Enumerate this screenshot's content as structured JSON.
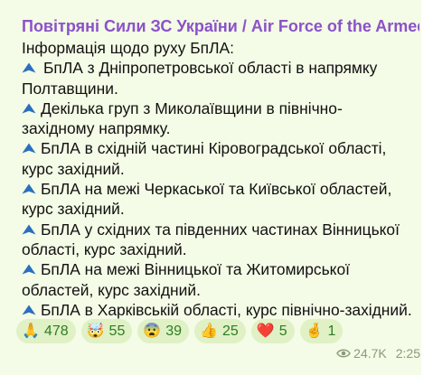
{
  "post": {
    "channel": "Повітряні Сили ЗС України / Air Force of the Armed F...",
    "heading": "Інформація щодо руху БпЛА:",
    "items": [
      [
        "БпЛА з Дніпропетровської області в напрямку",
        "Полтавщини."
      ],
      [
        "Декілька груп з Миколаївщини в північно-",
        "західному напрямку."
      ],
      [
        "БпЛА в східній частині Кіровоградської області,",
        "курс західний."
      ],
      [
        "БпЛА на межі Черкаської та Київської областей,",
        "курс західний."
      ],
      [
        "БпЛА у східних та південних частинах Вінницької",
        "області, курс західний."
      ],
      [
        "БпЛА на межі Вінницької та Житомирської",
        "областей, курс західний."
      ],
      [
        "БпЛА в Харківській області, курс північно-західний."
      ]
    ],
    "item_icon": "drone-icon"
  },
  "reactions": [
    {
      "emoji": "🙏",
      "count": "478",
      "icon": "pray-icon"
    },
    {
      "emoji": "🤯",
      "count": "55",
      "icon": "mind-blown-icon"
    },
    {
      "emoji": "😨",
      "count": "39",
      "icon": "fearful-face-icon"
    },
    {
      "emoji": "👍",
      "count": "25",
      "icon": "thumbs-up-icon"
    },
    {
      "emoji": "❤️",
      "count": "5",
      "icon": "heart-icon"
    },
    {
      "emoji": "🤞",
      "count": "1",
      "icon": "crossed-fingers-icon"
    }
  ],
  "meta": {
    "views": "24.7K",
    "time": "2:25",
    "view_icon": "eye-icon"
  },
  "colors": {
    "bubble": "#f4fbe6",
    "channel": "#8b52c9",
    "reaction_bg": "#dff1c5",
    "reaction_text": "#2f7d23",
    "meta": "#8a9a7a"
  }
}
